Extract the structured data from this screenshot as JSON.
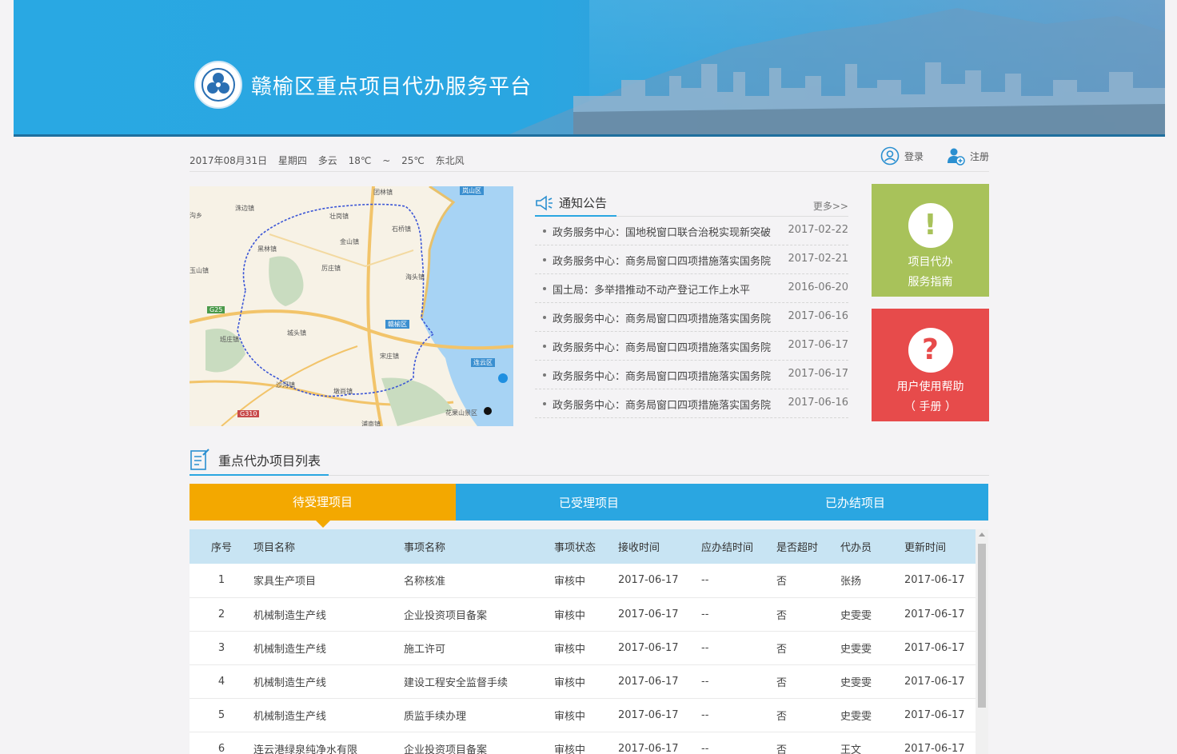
{
  "header": {
    "title": "赣榆区重点项目代办服务平台"
  },
  "infobar": {
    "date": "2017年08月31日",
    "weekday": "星期四",
    "weather": "多云",
    "temp_low": "18℃",
    "sep": "~",
    "temp_high": "25℃",
    "wind": "东北风"
  },
  "auth": {
    "login": "登录",
    "register": "注册"
  },
  "map": {
    "labels": [
      "团林镇",
      "洙边镇",
      "岚山区",
      "沟乡",
      "壮岗镇",
      "石桥镇",
      "黑林镇",
      "金山镇",
      "玉山镇",
      "厉庄镇",
      "海头镇",
      "G25",
      "赣榆区",
      "城头镇",
      "班庄镇",
      "宋庄镇",
      "连云区",
      "沙河镇",
      "墩尚镇",
      "G310",
      "花果山景区",
      "浦南镇"
    ]
  },
  "notice": {
    "title": "通知公告",
    "more": "更多>>",
    "items": [
      {
        "text": "政务服务中心：国地税窗口联合治税实现新突破",
        "date": "2017-02-22"
      },
      {
        "text": "政务服务中心：商务局窗口四项措施落实国务院",
        "date": "2017-02-21"
      },
      {
        "text": "国土局：多举措推动不动产登记工作上水平",
        "date": "2016-06-20"
      },
      {
        "text": "政务服务中心：商务局窗口四项措施落实国务院",
        "date": "2017-06-16"
      },
      {
        "text": "政务服务中心：商务局窗口四项措施落实国务院",
        "date": "2017-06-17"
      },
      {
        "text": "政务服务中心：商务局窗口四项措施落实国务院",
        "date": "2017-06-17"
      },
      {
        "text": "政务服务中心：商务局窗口四项措施落实国务院",
        "date": "2017-06-16"
      }
    ]
  },
  "tiles": {
    "guide": {
      "line1": "项目代办",
      "line2": "服务指南",
      "icon": "!"
    },
    "help": {
      "line1": "用户使用帮助",
      "line2": "（ 手册 ）",
      "icon": "?"
    }
  },
  "projects": {
    "title": "重点代办项目列表",
    "tabs": [
      "待受理项目",
      "已受理项目",
      "已办结项目"
    ],
    "columns": [
      "序号",
      "项目名称",
      "事项名称",
      "事项状态",
      "接收时间",
      "应办结时间",
      "是否超时",
      "代办员",
      "更新时间"
    ],
    "rows": [
      [
        "1",
        "家具生产项目",
        "名称核准",
        "审核中",
        "2017-06-17",
        "--",
        "否",
        "张扬",
        "2017-06-17"
      ],
      [
        "2",
        "机械制造生产线",
        "企业投资项目备案",
        "审核中",
        "2017-06-17",
        "--",
        "否",
        "史雯雯",
        "2017-06-17"
      ],
      [
        "3",
        "机械制造生产线",
        "施工许可",
        "审核中",
        "2017-06-17",
        "--",
        "否",
        "史雯雯",
        "2017-06-17"
      ],
      [
        "4",
        "机械制造生产线",
        "建设工程安全监督手续",
        "审核中",
        "2017-06-17",
        "--",
        "否",
        "史雯雯",
        "2017-06-17"
      ],
      [
        "5",
        "机械制造生产线",
        "质监手续办理",
        "审核中",
        "2017-06-17",
        "--",
        "否",
        "史雯雯",
        "2017-06-17"
      ],
      [
        "6",
        "连云港绿泉纯净水有限",
        "企业投资项目备案",
        "审核中",
        "2017-06-17",
        "--",
        "否",
        "王文",
        "2017-06-17"
      ]
    ]
  },
  "colors": {
    "blue": "#2aa6e1",
    "orange": "#f3a800",
    "green": "#a8c25a",
    "red": "#e74b4b"
  }
}
